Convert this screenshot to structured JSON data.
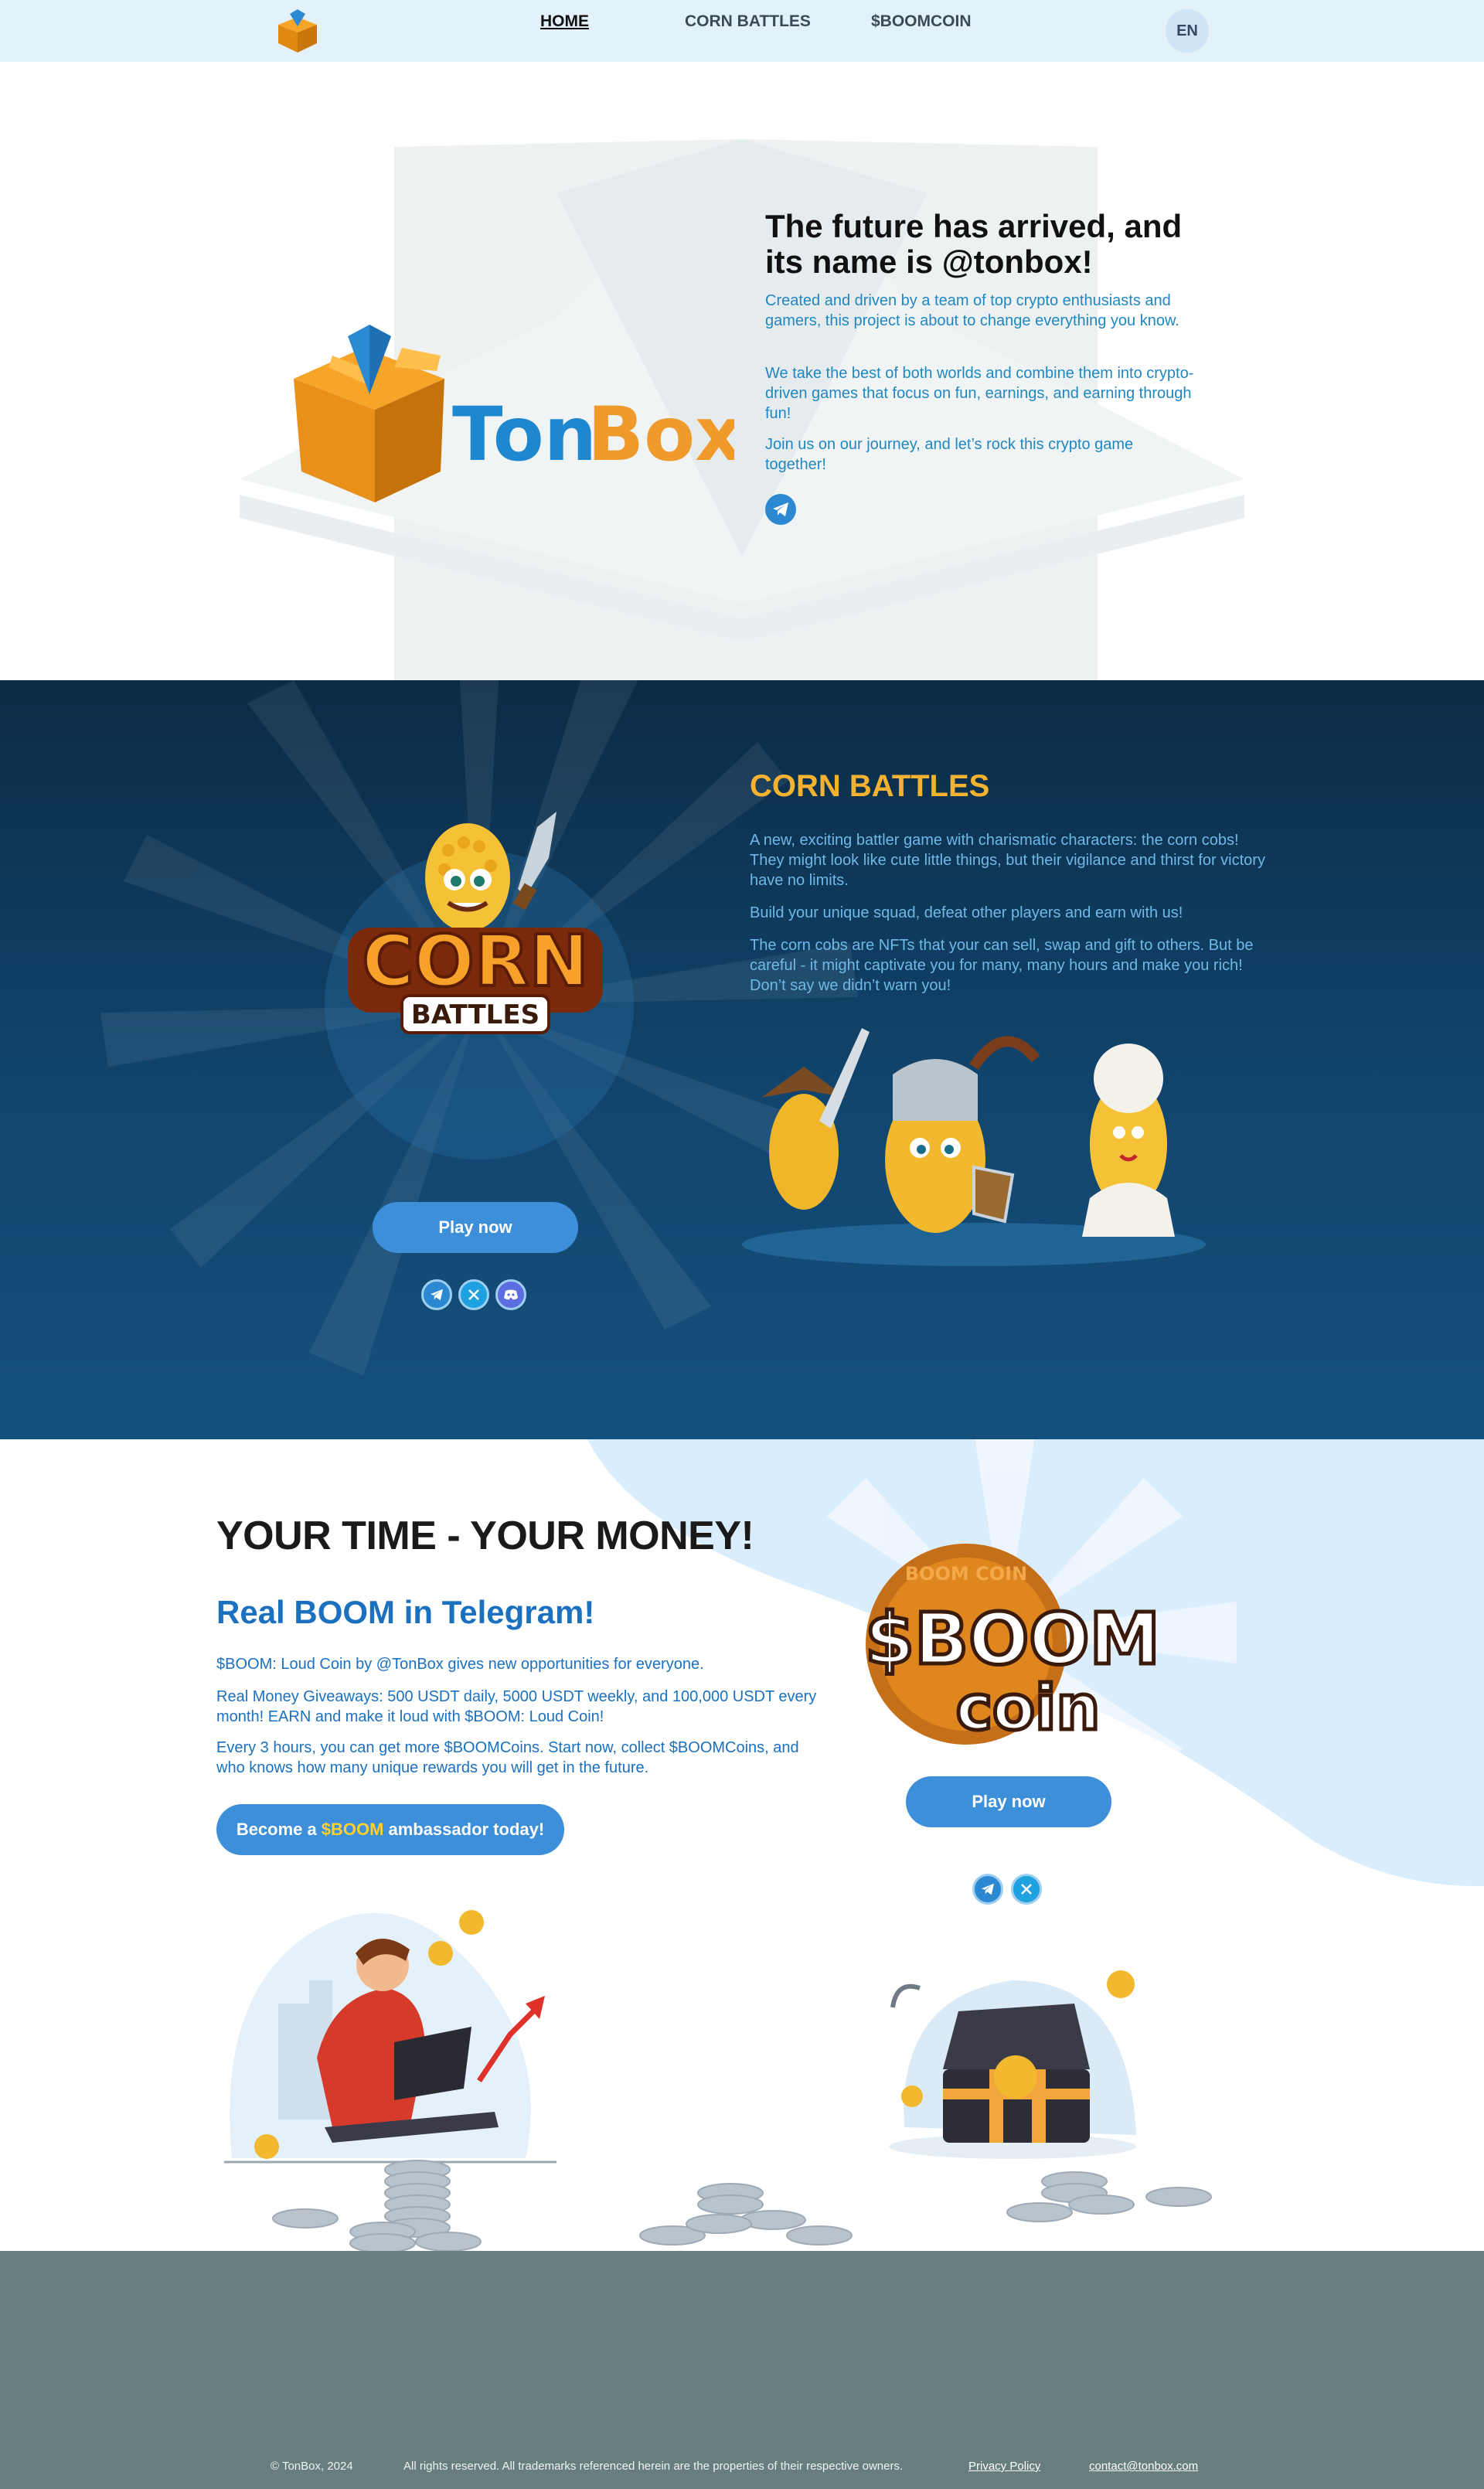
{
  "nav": {
    "logo_icon": "tonbox-box-icon",
    "links": [
      {
        "label": "HOME",
        "active": true
      },
      {
        "label": "CORN BATTLES",
        "active": false
      },
      {
        "label": "$BOOMCOIN",
        "active": false
      }
    ],
    "language": "EN"
  },
  "hero": {
    "logo_text_ton": "Ton",
    "logo_text_box": "Box",
    "title": "The future has arrived, and its name is @tonbox!",
    "paragraphs": [
      "Created and driven by a team of top crypto enthusiasts and gamers, this project is about to change everything you know.",
      "We take the best of both worlds and combine them into crypto-driven games that focus on fun, earnings, and earning through fun!",
      "Join us on our journey, and let’s rock this crypto game together!"
    ],
    "social_icon": "telegram-icon"
  },
  "corn": {
    "title": "CORN BATTLES",
    "paragraphs": [
      "A new, exciting battler game with charismatic characters: the corn cobs! They might look like cute little things, but their vigilance and thirst for victory have no limits.",
      "Build your unique squad, defeat other players and earn with us!",
      "The corn cobs are NFTs that your can sell, swap and gift to others. But be careful - it might captivate you for many, many hours and make you rich! Don’t say we didn’t warn you!"
    ],
    "logo_word1": "CORN",
    "logo_word2": "BATTLES",
    "play_label": "Play now",
    "socials": [
      "telegram-icon",
      "x-icon",
      "discord-icon"
    ]
  },
  "boom": {
    "heading": "YOUR TIME - YOUR MONEY!",
    "subheading": "Real BOOM in Telegram!",
    "paragraphs": [
      "$BOOM: Loud Coin by @TonBox gives new opportunities for everyone.",
      "Real Money Giveaways: 500 USDT daily, 5000 USDT weekly, and 100,000 USDT every month! EARN and make it loud with $BOOM: Loud Coin!",
      "Every 3 hours, you can get more $BOOMCoins. Start now, collect $BOOMCoins, and who knows how many unique rewards you will get in the future."
    ],
    "ambassador_pre": "Become a",
    "ambassador_highlight": "$BOOM",
    "ambassador_post": "ambassador today!",
    "coin_ring_text": "BOOM COIN",
    "coin_word1": "$BOOM",
    "coin_word2": "coin",
    "play_label": "Play now",
    "socials": [
      "telegram-icon",
      "x-icon"
    ]
  },
  "footer": {
    "copyright": "© TonBox, 2024",
    "rights": "All rights reserved. All trademarks referenced herein are the properties of their respective owners.",
    "privacy": "Privacy Policy",
    "contact": "contact@tonbox.com"
  },
  "colors": {
    "accent_blue": "#3c8fd8",
    "text_blue": "#1f87c1",
    "corn_gold": "#f4b230",
    "footer_gray": "#677d7e",
    "nav_bg": "#e3f1fb"
  }
}
